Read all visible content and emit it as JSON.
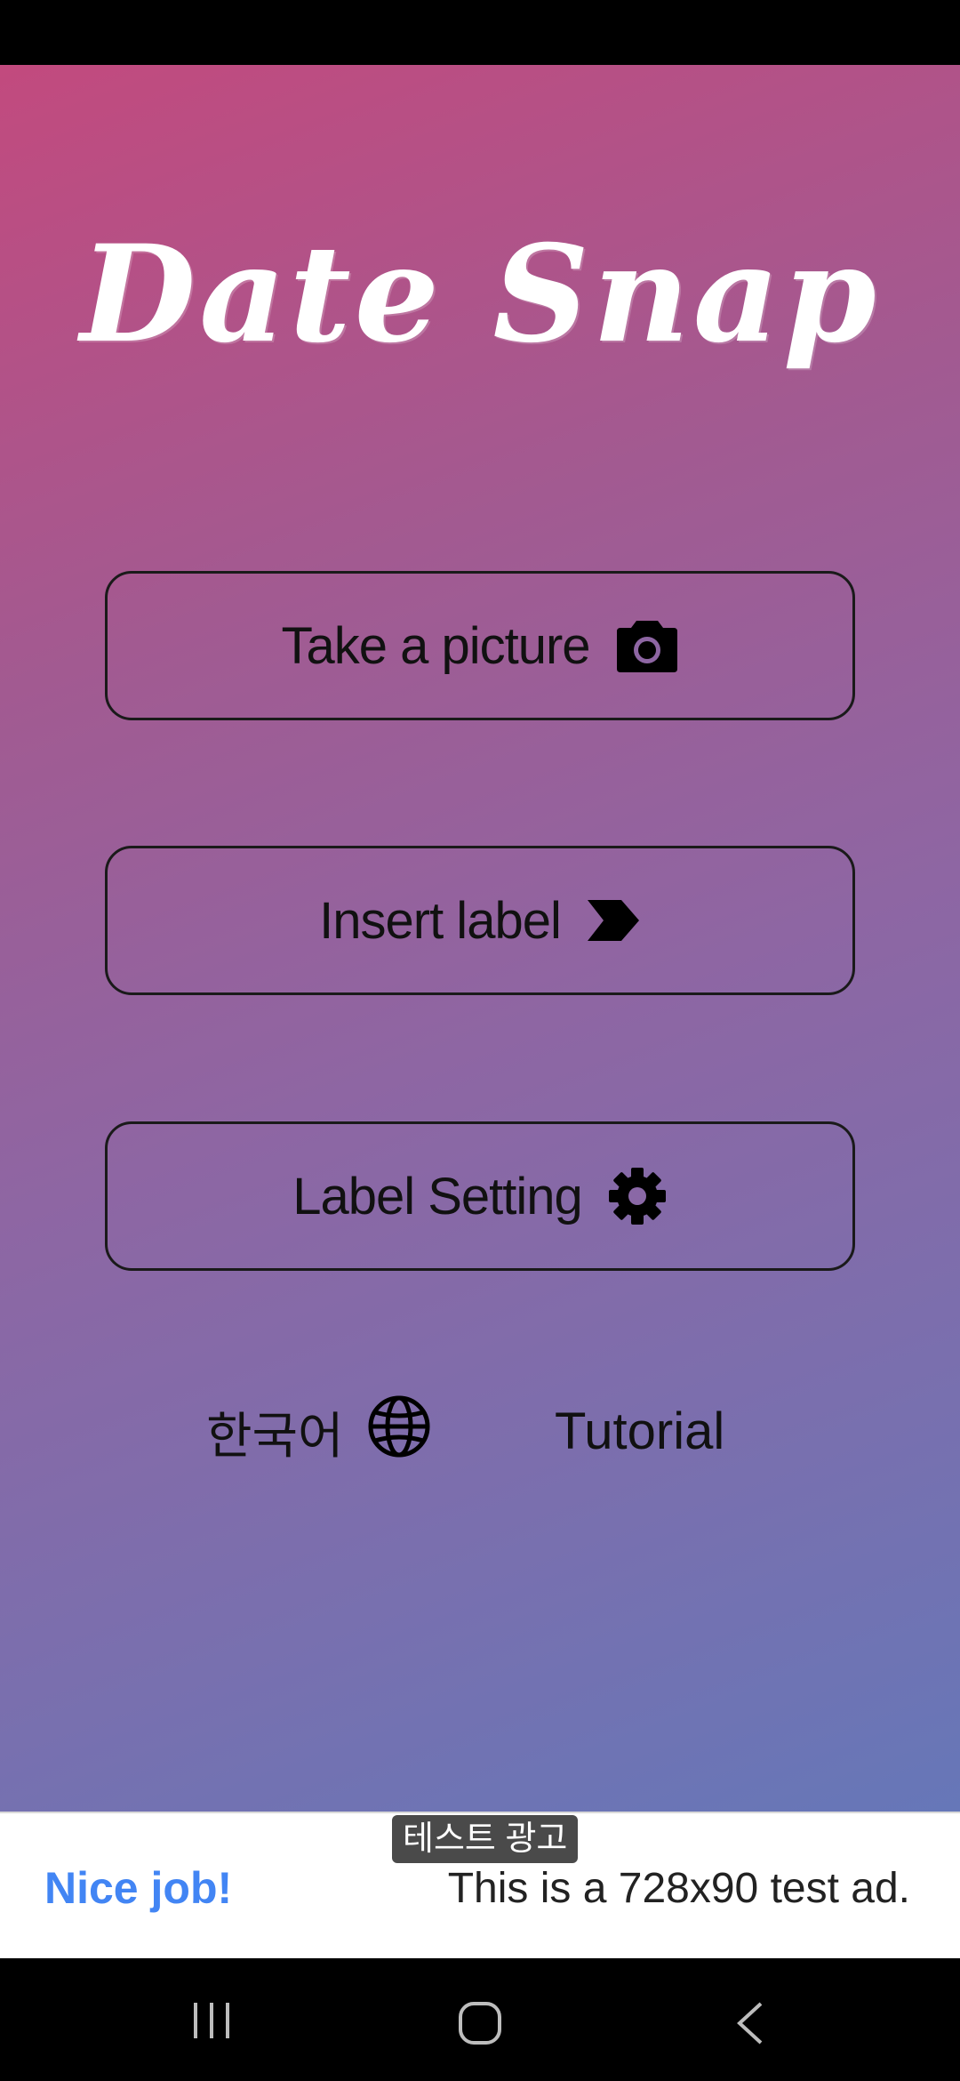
{
  "app": {
    "title": "Date Snap"
  },
  "buttons": {
    "take_picture": "Take a picture",
    "insert_label": "Insert label",
    "label_setting": "Label Setting"
  },
  "footer": {
    "language": "한국어",
    "tutorial": "Tutorial"
  },
  "ad": {
    "badge": "테스트 광고",
    "headline": "Nice job!",
    "body": "This is a 728x90 test ad."
  },
  "icons": {
    "take_picture": "camera-icon",
    "insert_label": "label-tag-icon",
    "label_setting": "gear-icon",
    "language": "globe-icon"
  },
  "colors": {
    "gradient_top": "#c24a7e",
    "gradient_bottom": "#6677b8",
    "ad_headline": "#4285f4"
  }
}
